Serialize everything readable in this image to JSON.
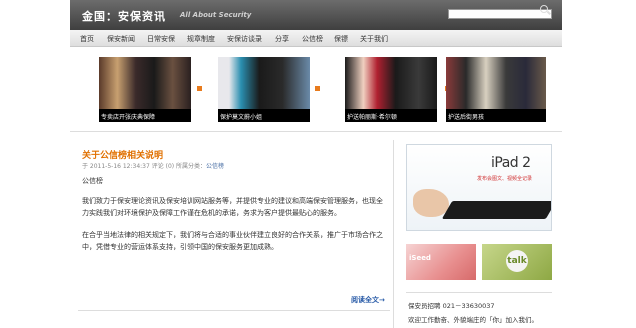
{
  "header": {
    "title": "金国：安保资讯",
    "subtitle": "All About Security",
    "search_placeholder": ""
  },
  "nav": {
    "items": [
      "首页",
      "保安新闻",
      "日常安保",
      "规章制度",
      "安保访谈录",
      "分享",
      "公信榜",
      "保镖",
      "关于我们"
    ]
  },
  "slider": {
    "slides": [
      {
        "caption": "专卖店开张庆典保障"
      },
      {
        "caption": "保护莫文蔚小姐"
      },
      {
        "caption": "护送帕丽斯·希尔顿"
      },
      {
        "caption": "护送后街男孩"
      }
    ]
  },
  "article": {
    "title": "关于公信榜相关说明",
    "meta_prefix": "于 2011-5-16 12:34:37  评论 (0)  所属分类：",
    "category": "公信榜",
    "paragraphs": [
      "公信榜",
      "我们致力于保安理论资讯及保安培训网站服务等，并提供专业的建议和高端保安管理服务，也现全力实践我们对环境保护及保障工作谨在危机的承诺，务求为客户提供最贴心的服务。",
      "在合乎当地法律的相关规定下，我们将与合适的事业伙伴建立良好的合作关系，推广于市场合作之中，凭借专业的营运体系支持，引领中国的保安服务更加成熟。"
    ],
    "read_more": "阅读全文→"
  },
  "sidebar": {
    "ipad_brand": "iPad 2",
    "ipad_slogan": "发布会图文、视频全记录",
    "ad2_text": "iSeed",
    "ad3_text": "talk",
    "contact_line1": "保安员招聘  021－33630037",
    "contact_line2": "欢迎工作勤奋、外貌端庄的「你」加入我们。"
  },
  "colors": {
    "accent": "#e07000",
    "link": "#2a5ca8",
    "header_bg": "#4a4a4a"
  }
}
